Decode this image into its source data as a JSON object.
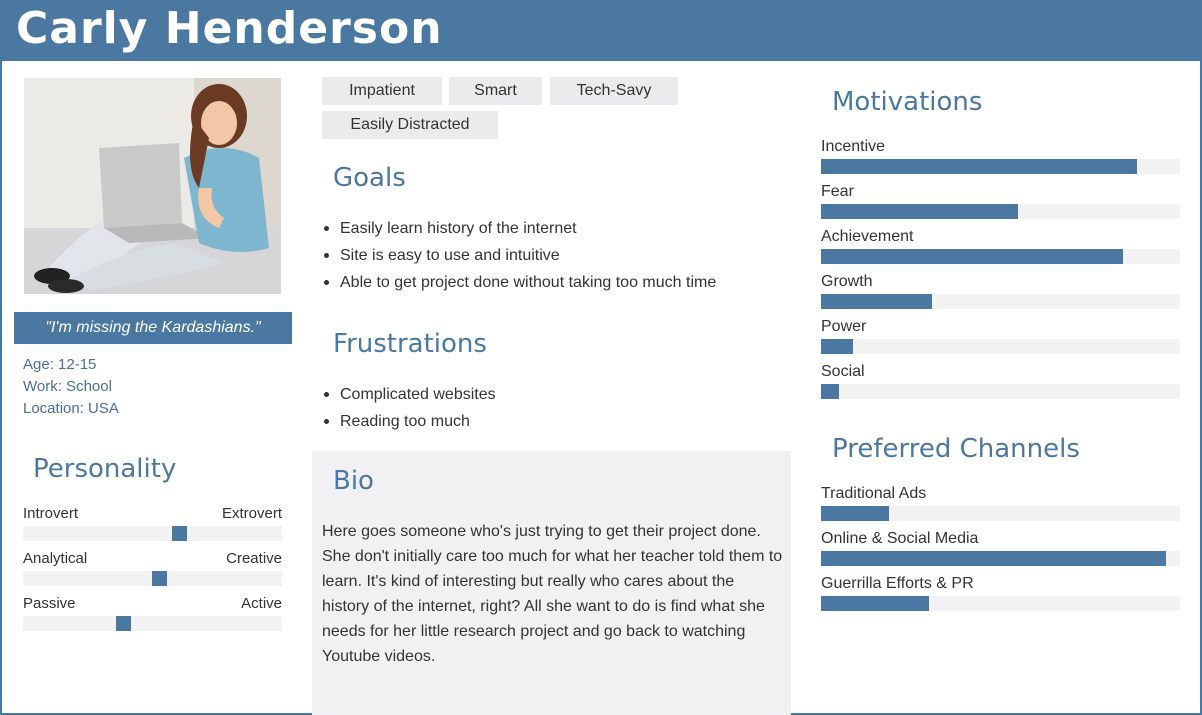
{
  "persona": {
    "name": "Carly Henderson",
    "quote": "\"I'm missing the Kardashians.\"",
    "age": "Age: 12-15",
    "work": "Work: School",
    "location": "Location: USA"
  },
  "tags": [
    "Impatient",
    "Smart",
    "Tech-Savy",
    "Easily Distracted"
  ],
  "goals": {
    "title": "Goals",
    "items": [
      "Easily learn history of the internet",
      "Site is easy to use and intuitive",
      "Able to get project done without taking too much time"
    ]
  },
  "frustrations": {
    "title": "Frustrations",
    "items": [
      "Complicated websites",
      "Reading too much"
    ]
  },
  "bio": {
    "title": "Bio",
    "text": "Here goes someone who's just trying to get their project done. She don't initially care too much for what her teacher told them to learn. It's kind of interesting but really who cares about the history of the internet, right? All she want to do is find what she needs for her little research project and go back to watching Youtube videos."
  },
  "personality": {
    "title": "Personality",
    "sliders": [
      {
        "left": "Introvert",
        "right": "Extrovert",
        "value": 0.61
      },
      {
        "left": "Analytical",
        "right": "Creative",
        "value": 0.53
      },
      {
        "left": "Passive",
        "right": "Active",
        "value": 0.38
      }
    ]
  },
  "motivations": {
    "title": "Motivations",
    "items": [
      {
        "label": "Incentive",
        "value": 0.88
      },
      {
        "label": "Fear",
        "value": 0.55
      },
      {
        "label": "Achievement",
        "value": 0.84
      },
      {
        "label": "Growth",
        "value": 0.31
      },
      {
        "label": "Power",
        "value": 0.09
      },
      {
        "label": "Social",
        "value": 0.05
      }
    ]
  },
  "channels": {
    "title": "Preferred Channels",
    "items": [
      {
        "label": "Traditional Ads",
        "value": 0.19
      },
      {
        "label": "Online & Social Media",
        "value": 0.96
      },
      {
        "label": "Guerrilla Efforts & PR",
        "value": 0.3
      }
    ]
  },
  "colors": {
    "accent": "#4a78a0",
    "track": "#f2f2f3",
    "panel": "#f1f1f3"
  }
}
